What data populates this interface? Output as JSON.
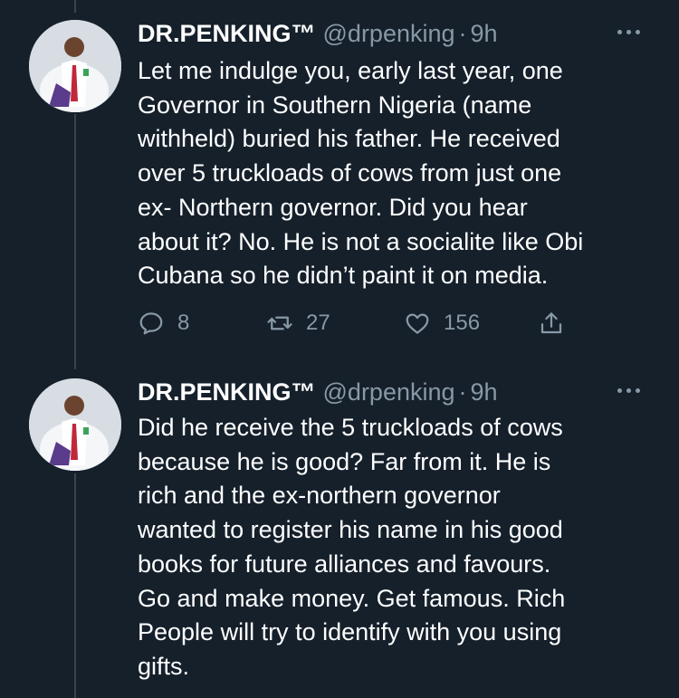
{
  "tweets": [
    {
      "display_name": "DR.PENKING™",
      "handle": "@drpenking",
      "separator": "·",
      "time": "9h",
      "lines": [
        "Let me indulge you, early last year, one",
        "Governor in Southern Nigeria (name",
        "withheld) buried his father. He received",
        "over 5 truckloads of cows from just one",
        "ex- Northern governor. Did you hear",
        "about it? No. He is not a socialite like Obi",
        "Cubana so he didn’t paint it on media."
      ],
      "replies": "8",
      "retweets": "27",
      "likes": "156",
      "icons": [
        "reply-icon",
        "retweet-icon",
        "like-icon",
        "share-icon"
      ]
    },
    {
      "display_name": "DR.PENKING™",
      "handle": "@drpenking",
      "separator": "·",
      "time": "9h",
      "lines": [
        "Did he receive the 5 truckloads of cows",
        "because he is good? Far from it. He is",
        "rich and the ex-northern governor",
        "wanted to register his name in his good",
        "books for future alliances and favours.",
        "Go and make money. Get famous. Rich",
        "People will try to identify with you using",
        "gifts."
      ]
    }
  ],
  "colors": {
    "background": "#15202b",
    "text": "#ffffff",
    "muted": "#8899a6",
    "thread_line": "#38444d"
  }
}
